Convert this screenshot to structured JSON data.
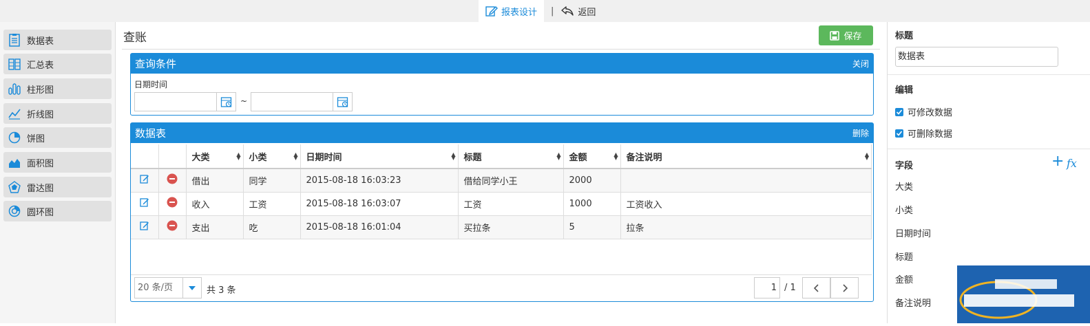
{
  "topbar": {
    "design_label": "报表设计",
    "separator": "|",
    "back_label": "返回"
  },
  "sidebar": {
    "items": [
      {
        "label": "数据表",
        "icon": "table-icon"
      },
      {
        "label": "汇总表",
        "icon": "summary-table-icon"
      },
      {
        "label": "柱形图",
        "icon": "bar-chart-icon"
      },
      {
        "label": "折线图",
        "icon": "line-chart-icon"
      },
      {
        "label": "饼图",
        "icon": "pie-chart-icon"
      },
      {
        "label": "面积图",
        "icon": "area-chart-icon"
      },
      {
        "label": "雷达图",
        "icon": "radar-chart-icon"
      },
      {
        "label": "圆环图",
        "icon": "donut-chart-icon"
      }
    ]
  },
  "main": {
    "title": "查账",
    "save_label": "保存",
    "query": {
      "title": "查询条件",
      "close_label": "关闭",
      "date_label": "日期时间",
      "range_sep": "~"
    },
    "table": {
      "title": "数据表",
      "delete_label": "删除",
      "columns": [
        "大类",
        "小类",
        "日期时间",
        "标题",
        "金额",
        "备注说明"
      ],
      "rows": [
        [
          "借出",
          "同学",
          "2015-08-18 16:03:23",
          "借给同学小王",
          "2000",
          ""
        ],
        [
          "收入",
          "工资",
          "2015-08-18 16:03:07",
          "工资",
          "1000",
          "工资收入"
        ],
        [
          "支出",
          "吃",
          "2015-08-18 16:01:04",
          "买拉条",
          "5",
          "拉条"
        ]
      ]
    },
    "pager": {
      "page_size": "20 条/页",
      "total": "共 3 条",
      "current_page": "1",
      "page_of": "/ 1"
    }
  },
  "right": {
    "title_heading": "标题",
    "title_value": "数据表",
    "edit_heading": "编辑",
    "edit_options": [
      "可修改数据",
      "可删除数据"
    ],
    "fields_heading": "字段",
    "fx_label": "fx",
    "fields": [
      "大类",
      "小类",
      "日期时间",
      "标题",
      "金额",
      "备注说明"
    ]
  },
  "colors": {
    "accent": "#1b8bd9",
    "save": "#5cb85c",
    "delete": "#d9534f"
  }
}
